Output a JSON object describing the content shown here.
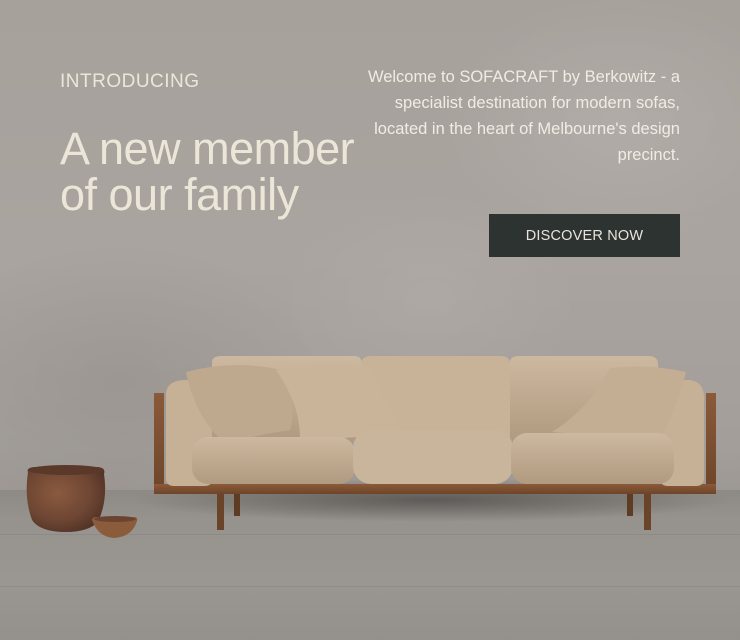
{
  "hero": {
    "eyebrow": "INTRODUCING",
    "headline": "A new member of our family",
    "intro": "Welcome to SOFACRAFT by Berkowitz - a specialist destination for modern sofas, located in the heart of Melbourne's design precinct.",
    "cta_label": "DISCOVER NOW"
  },
  "colors": {
    "text_light": "#ece6d9",
    "cta_background": "#2d3330",
    "sofa_fabric": "#c2ad93",
    "sofa_frame": "#7e5034"
  }
}
